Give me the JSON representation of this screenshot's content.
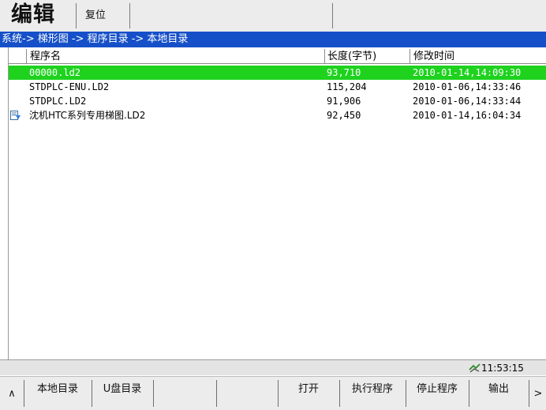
{
  "header": {
    "mode_title": "编辑",
    "reset_label": "复位"
  },
  "breadcrumb": "系统-> 梯形图 -> 程序目录 -> 本地目录",
  "table": {
    "columns": [
      "程序名",
      "长度(字节)",
      "修改时间"
    ],
    "rows": [
      {
        "name": "00000.ld2",
        "size": "93,710",
        "modified": "2010-01-14,14:09:30",
        "selected": true
      },
      {
        "name": "STDPLC-ENU.LD2",
        "size": "115,204",
        "modified": "2010-01-06,14:33:46",
        "selected": false
      },
      {
        "name": "STDPLC.LD2",
        "size": "91,906",
        "modified": "2010-01-06,14:33:44",
        "selected": false
      },
      {
        "name": "沈机HTC系列专用梯图.LD2",
        "size": "92,450",
        "modified": "2010-01-14,16:04:34",
        "selected": false,
        "icon": "loaded-file-icon"
      }
    ]
  },
  "status": {
    "time": "11:53:15",
    "icon": "network-connection-icon"
  },
  "softkeys": {
    "prev": "∧",
    "local_dir": "本地目录",
    "usb_dir": "U盘目录",
    "open": "打开",
    "run_program": "执行程序",
    "stop_program": "停止程序",
    "output": "输出",
    "next": ">"
  },
  "colors": {
    "breadcrumb_bg": "#1650c8",
    "selected_row_bg": "#1ed21e",
    "bar_bg": "#ececec"
  }
}
